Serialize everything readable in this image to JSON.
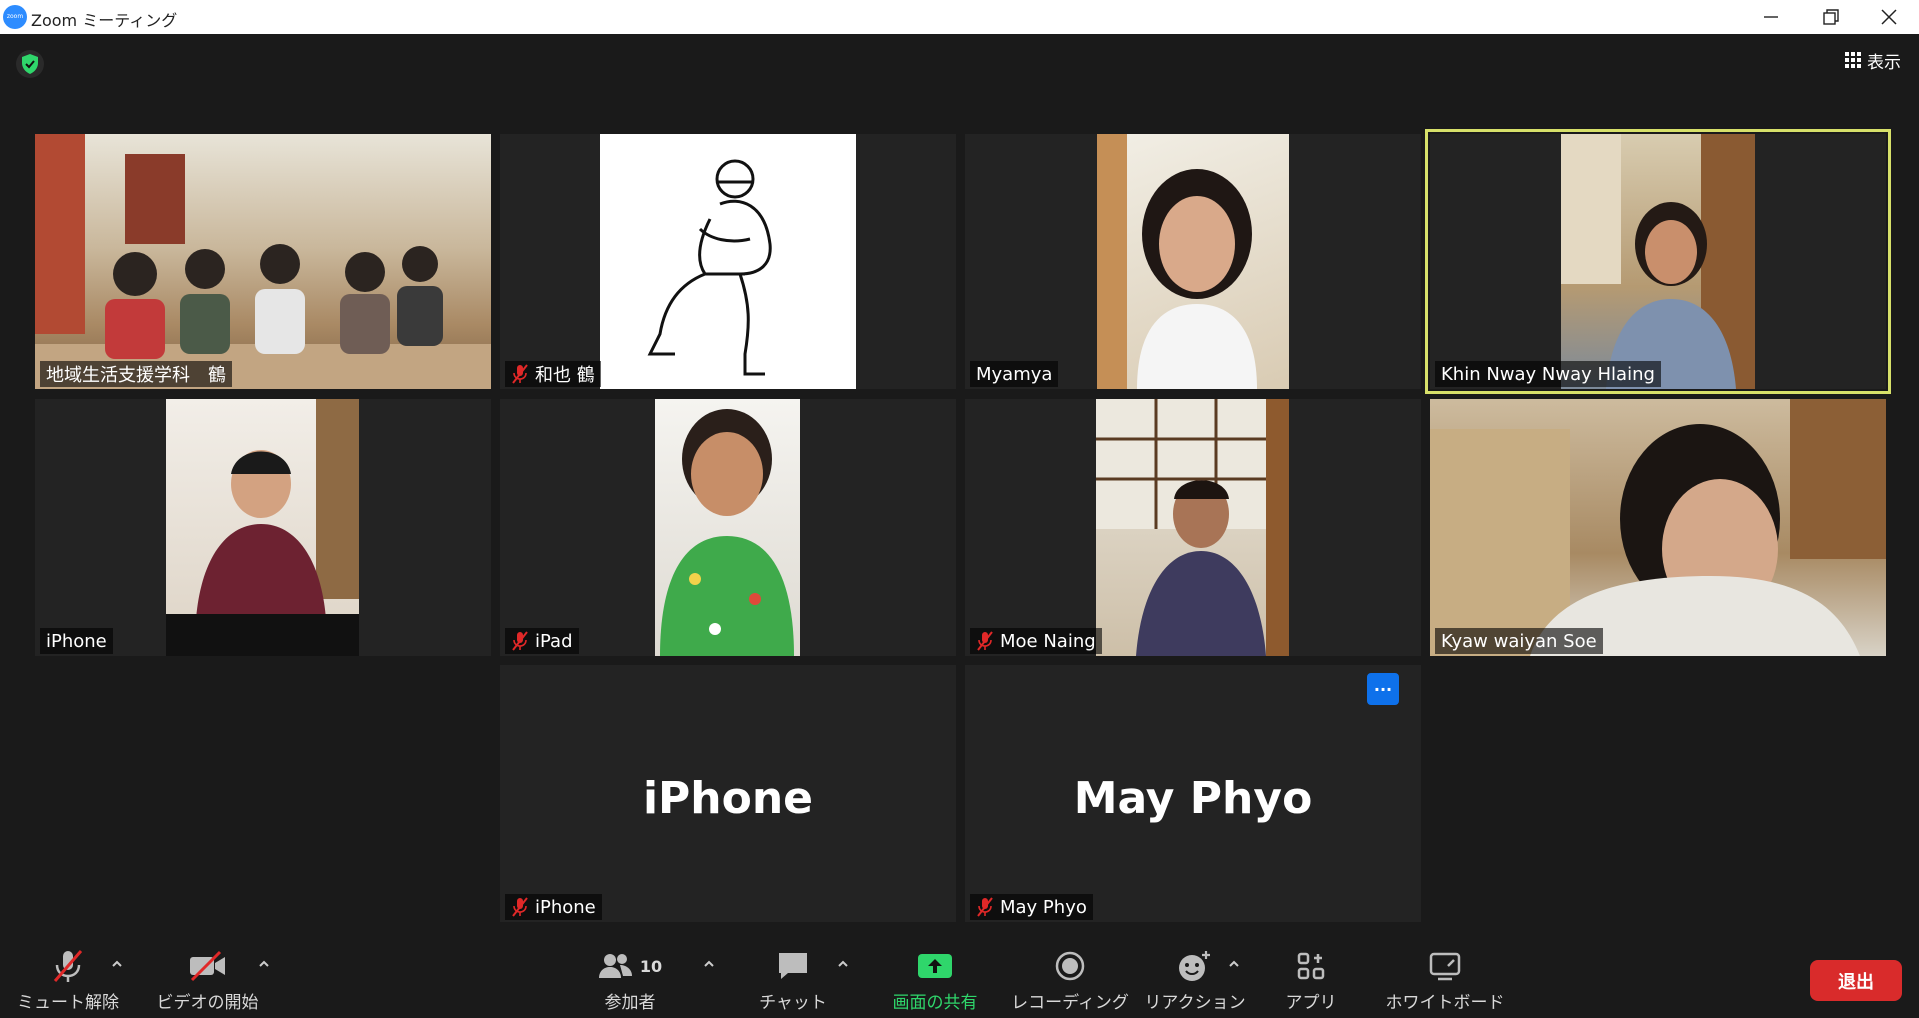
{
  "window": {
    "title": "Zoom ミーティング",
    "logo_text": "zoom"
  },
  "top": {
    "view_label": "表示"
  },
  "participants": [
    {
      "name": "地域生活支援学科　鶴",
      "muted": false
    },
    {
      "name": "和也 鶴",
      "muted": true
    },
    {
      "name": "Myamya",
      "muted": false
    },
    {
      "name": "Khin Nway Nway Hlaing",
      "muted": false,
      "active_speaker": true
    },
    {
      "name": "iPhone",
      "muted": false
    },
    {
      "name": "iPad",
      "muted": true
    },
    {
      "name": "Moe Naing",
      "muted": true
    },
    {
      "name": "Kyaw waiyan Soe",
      "muted": false
    },
    {
      "name": "iPhone",
      "muted": true,
      "video_off": true,
      "display_name": "iPhone"
    },
    {
      "name": "May Phyo",
      "muted": true,
      "video_off": true,
      "display_name": "May Phyo"
    }
  ],
  "toolbar": {
    "unmute": "ミュート解除",
    "start_video": "ビデオの開始",
    "participants": "参加者",
    "participant_count": "10",
    "chat": "チャット",
    "share_screen": "画面の共有",
    "recording": "レコーディング",
    "reactions": "リアクション",
    "apps": "アプリ",
    "whiteboard": "ホワイトボード",
    "leave": "退出"
  },
  "more_button": "···",
  "colors": {
    "active_border": "#d7e06a",
    "share_green": "#2fd66b",
    "leave_red": "#d92b2b",
    "more_blue": "#0e71eb"
  }
}
